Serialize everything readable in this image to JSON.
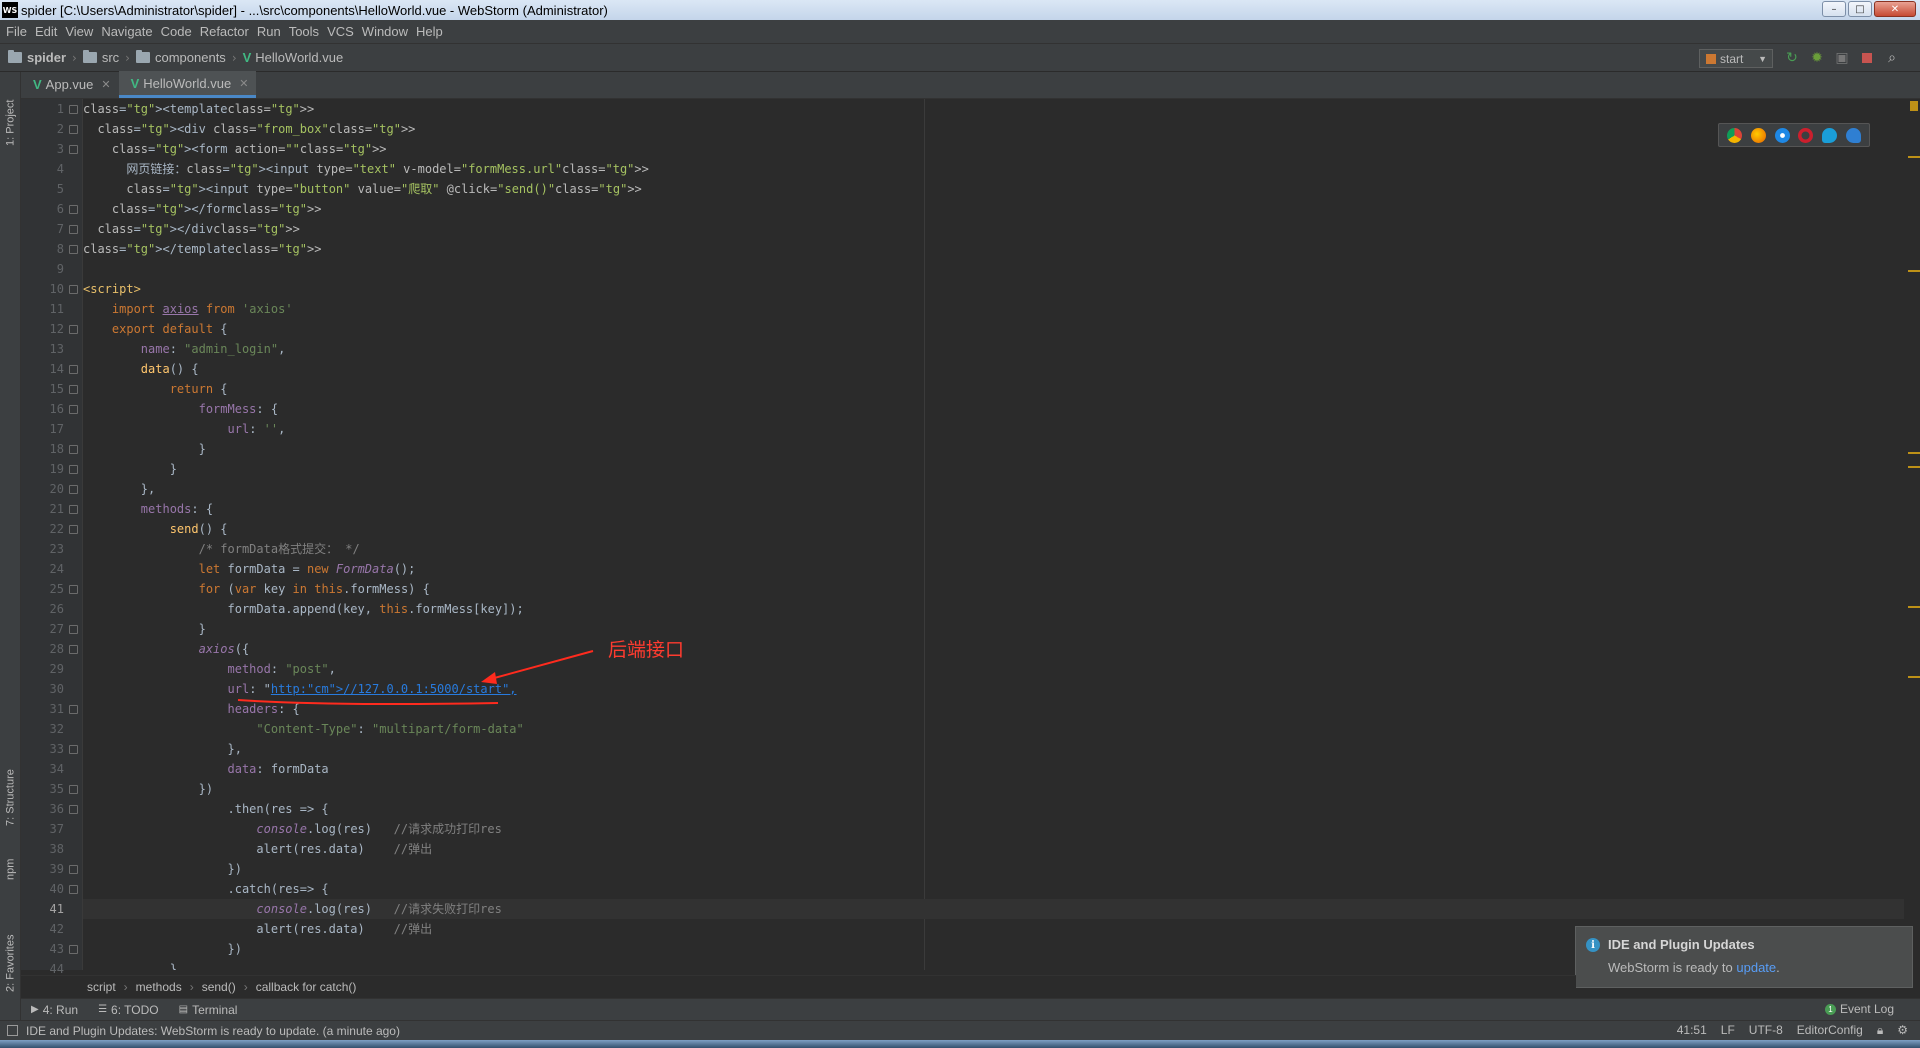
{
  "window": {
    "title": "spider [C:\\Users\\Administrator\\spider] - ...\\src\\components\\HelloWorld.vue - WebStorm (Administrator)",
    "app_icon": "WS"
  },
  "menu": [
    {
      "label": "File"
    },
    {
      "label": "Edit"
    },
    {
      "label": "View"
    },
    {
      "label": "Navigate"
    },
    {
      "label": "Code"
    },
    {
      "label": "Refactor"
    },
    {
      "label": "Run"
    },
    {
      "label": "Tools"
    },
    {
      "label": "VCS"
    },
    {
      "label": "Window"
    },
    {
      "label": "Help"
    }
  ],
  "navbar": {
    "crumbs": [
      "spider",
      "src",
      "components",
      "HelloWorld.vue"
    ],
    "run_config": "start",
    "tools": [
      "run-icon",
      "debug-icon",
      "coverage-icon",
      "stop-icon",
      "search-icon"
    ]
  },
  "left_tabs": [
    "1: Project",
    "7: Structure",
    "npm",
    "2: Favorites"
  ],
  "tabs": [
    {
      "label": "App.vue",
      "active": false
    },
    {
      "label": "HelloWorld.vue",
      "active": true
    }
  ],
  "editor": {
    "current_line": 41,
    "line_numbers": [
      "1",
      "2",
      "3",
      "4",
      "5",
      "6",
      "7",
      "8",
      "9",
      "10",
      "11",
      "12",
      "13",
      "14",
      "15",
      "16",
      "17",
      "18",
      "19",
      "20",
      "21",
      "22",
      "23",
      "24",
      "25",
      "26",
      "27",
      "28",
      "29",
      "30",
      "31",
      "32",
      "33",
      "34",
      "35",
      "36",
      "37",
      "38",
      "39",
      "40",
      "41",
      "42",
      "43",
      "44"
    ],
    "lines": [
      "<template>",
      "  <div class=\"from_box\">",
      "    <form action=\"\">",
      "      网页链接：<input type=\"text\" v-model=\"formMess.url\">",
      "      <input type=\"button\" value=\"爬取\" @click=\"send()\">",
      "    </form>",
      "  </div>",
      "</template>",
      "",
      "<script>",
      "    import axios from 'axios'",
      "    export default {",
      "        name: \"admin_login\",",
      "        data() {",
      "            return {",
      "                formMess: {",
      "                    url: '',",
      "                }",
      "            }",
      "        },",
      "        methods: {",
      "            send() {",
      "                /* formData格式提交： */",
      "                let formData = new FormData();",
      "                for (var key in this.formMess) {",
      "                    formData.append(key, this.formMess[key]);",
      "                }",
      "                axios({",
      "                    method: \"post\",",
      "                    url: \"http://127.0.0.1:5000/start\",",
      "                    headers: {",
      "                        \"Content-Type\": \"multipart/form-data\"",
      "                    },",
      "                    data: formData",
      "                })",
      "                    .then(res => {",
      "                        console.log(res)   //请求成功打印res",
      "                        alert(res.data)    //弹出",
      "                    })",
      "                    .catch(res=> {",
      "                        console.log(res)   //请求失败打印res",
      "                        alert(res.data)    //弹出",
      "                    })",
      "            }"
    ],
    "annotation": "后端接口"
  },
  "browsers": [
    "chrome-icon",
    "firefox-icon",
    "safari-icon",
    "opera-icon",
    "ie-icon",
    "edge-icon"
  ],
  "breadcrumb": [
    "script",
    "methods",
    "send()",
    "callback for catch()"
  ],
  "tool_windows": [
    {
      "label": "4: Run",
      "icon": "run-icon"
    },
    {
      "label": "6: TODO",
      "icon": "todo-icon"
    },
    {
      "label": "Terminal",
      "icon": "terminal-icon"
    }
  ],
  "event_log": "Event Log",
  "notification": {
    "title": "IDE and Plugin Updates",
    "body": "WebStorm is ready to ",
    "link": "update",
    "body_end": "."
  },
  "status": {
    "message": "IDE and Plugin Updates: WebStorm is ready to update. (a minute ago)",
    "position": "41:51",
    "line_sep": "LF",
    "encoding": "UTF-8",
    "editorconfig": "EditorConfig"
  },
  "colors": {
    "accent": "#4a88c7",
    "annotation": "#ff3b2f",
    "vue_logo": "#41b883"
  }
}
